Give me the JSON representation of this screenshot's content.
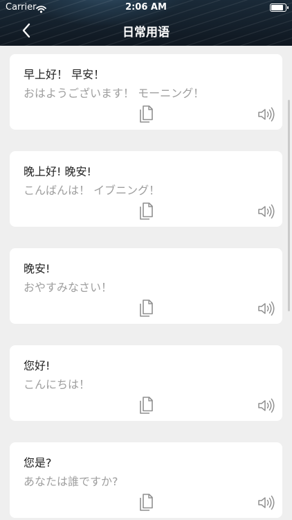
{
  "status_bar": {
    "carrier": "Carrier",
    "time": "2:06 AM",
    "battery_level": 0.95
  },
  "nav": {
    "title": "日常用语",
    "back_icon": "chevron-left-icon"
  },
  "phrases": [
    {
      "chinese": " 早上好！ 早安！",
      "japanese": "おはようございます！ モーニング！"
    },
    {
      "chinese": "晚上好! 晚安!",
      "japanese": "こんばんは！ イブニング！"
    },
    {
      "chinese": "晚安!",
      "japanese": "おやすみなさい！"
    },
    {
      "chinese": "您好!",
      "japanese": "こんにちは！"
    },
    {
      "chinese": "您是?",
      "japanese": "あなたは誰ですか?"
    }
  ],
  "icons": {
    "copy": "copy-icon",
    "speaker": "speaker-icon"
  }
}
